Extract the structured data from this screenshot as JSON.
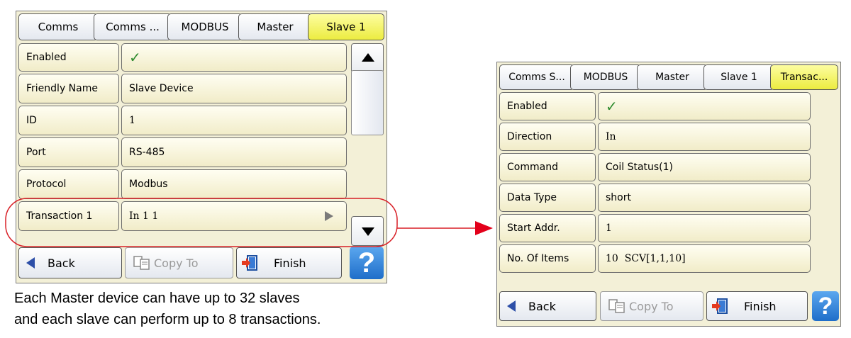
{
  "left_screen": {
    "breadcrumb": [
      "Comms",
      "Comms ...",
      "MODBUS",
      "Master",
      "Slave 1"
    ],
    "rows": [
      {
        "label": "Enabled",
        "value": "✓"
      },
      {
        "label": "Friendly Name",
        "value": "Slave Device"
      },
      {
        "label": "ID",
        "value": "1"
      },
      {
        "label": "Port",
        "value": "RS-485"
      },
      {
        "label": "Protocol",
        "value": "Modbus"
      },
      {
        "label": "Transaction 1",
        "value": "In 1 1"
      }
    ],
    "buttons": {
      "back": "Back",
      "copy_to": "Copy To",
      "finish": "Finish",
      "help": "?"
    }
  },
  "right_screen": {
    "breadcrumb": [
      "Comms S...",
      "MODBUS",
      "Master",
      "Slave 1",
      "Transac..."
    ],
    "rows": [
      {
        "label": "Enabled",
        "value": "✓"
      },
      {
        "label": "Direction",
        "value": "In"
      },
      {
        "label": "Command",
        "value": "Coil Status(1)"
      },
      {
        "label": "Data Type",
        "value": "short"
      },
      {
        "label": "Start Addr.",
        "value": "1"
      },
      {
        "label": "No. Of Items",
        "value": "10  SCV[1,1,10]"
      }
    ],
    "buttons": {
      "back": "Back",
      "copy_to": "Copy To",
      "finish": "Finish",
      "help": "?"
    }
  },
  "caption": {
    "line1": "Each Master device can have up to 32 slaves",
    "line2": "and each slave can perform up to 8 transactions."
  },
  "colors": {
    "annotation": "#d81f26",
    "current_crumb": "#f4f46a",
    "help": "#2f82db"
  }
}
